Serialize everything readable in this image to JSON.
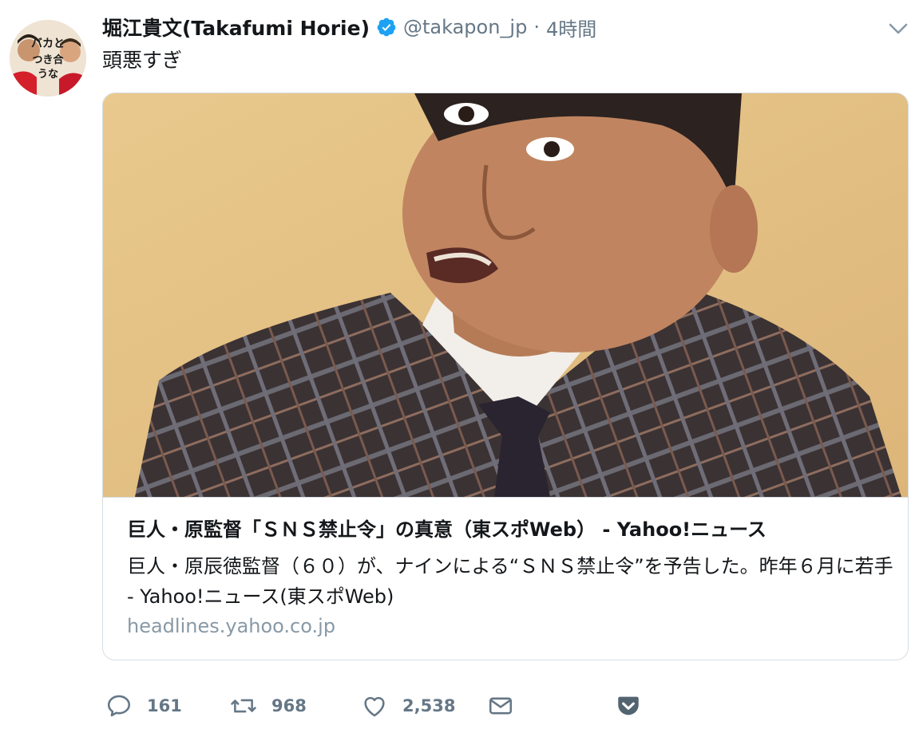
{
  "tweet": {
    "author_name": "堀江貴文(Takafumi Horie)",
    "handle": "@takapon_jp",
    "separator": "·",
    "time": "4時間",
    "text": "頭悪すぎ",
    "avatar_text": "バカと つき合うな"
  },
  "card": {
    "title": "巨人・原監督「ＳＮＳ禁止令」の真意（東スポWeb） - Yahoo!ニュース",
    "description": "巨人・原辰徳監督（６０）が、ナインによる“ＳＮＳ禁止令”を予告した。昨年６月に若手 - Yahoo!ニュース(東スポWeb)",
    "domain": "headlines.yahoo.co.jp"
  },
  "actions": {
    "reply_count": "161",
    "retweet_count": "968",
    "like_count": "2,538"
  },
  "colors": {
    "verified": "#1da1f2",
    "muted": "#657786",
    "pocket": "#536471"
  }
}
